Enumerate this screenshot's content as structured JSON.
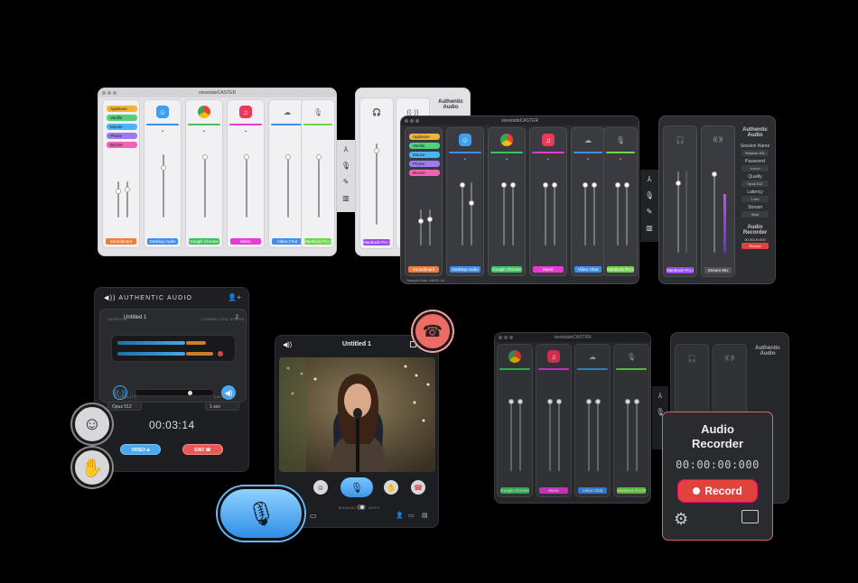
{
  "app_title": "viewstateCASTER",
  "routing_pills": [
    {
      "label": "Applause",
      "color": "#f0b43c"
    },
    {
      "label": "Vanilla",
      "color": "#4fd27a"
    },
    {
      "label": "Mouse",
      "color": "#4db3f5"
    },
    {
      "label": "Phone",
      "color": "#9b7cf2"
    },
    {
      "label": "Buzzer",
      "color": "#f064b4"
    }
  ],
  "channels": [
    {
      "name": "Soundboard",
      "color": "#f47a3a"
    },
    {
      "name": "Desktop Audio",
      "color": "#3d8ef0"
    },
    {
      "name": "Google Chrome",
      "color": "#3ec25f"
    },
    {
      "name": "Music",
      "color": "#e83ad6"
    },
    {
      "name": "Video Chat",
      "color": "#3d8ef0"
    },
    {
      "name": "MacBook Pro Mi...",
      "color": "#6fd44a"
    }
  ],
  "output_channels": [
    {
      "name": "MacBook Pro S...",
      "color": "#9b4df0"
    },
    {
      "name": "Stream Mix",
      "color": "#555"
    }
  ],
  "sample_rate": "Sample Rate: 48000 Hz",
  "side_panel": {
    "title": "Authentic Audio",
    "session_label": "Session Name",
    "session_value": "Session 401",
    "password_label": "Password",
    "password_value": "••••••••",
    "quality_label": "Quality",
    "quality_value": "Opus 512",
    "latency_label": "Latency",
    "latency_value": "1 sec",
    "stream_label": "Stream",
    "stream_value": "Start",
    "rec_title": "Audio Recorder",
    "rec_time": "00:00:00:000",
    "rec_button": "Record"
  },
  "aa": {
    "header": "AUTHENTIC AUDIO",
    "session_label": "SESSION",
    "session_name": "Untitled 1",
    "connected_label": "CONNECTED USERS",
    "connected_count": "2",
    "quality_label": "QUALITY",
    "quality_value": "Opus 512",
    "latency_label": "LATENCY",
    "latency_value": "1 sec",
    "timer": "00:03:14",
    "video_button": "VIDEO",
    "end_button": "END"
  },
  "video_call": {
    "title": "Untitled 1",
    "manual_label": "MANUAL",
    "auto_label": "AUTO"
  },
  "recorder": {
    "title_line1": "Audio",
    "title_line2": "Recorder",
    "time": "00:00:00:000",
    "record_label": "Record"
  },
  "colors": {
    "accent_blue": "#4aa8f0",
    "record_red": "#e0423e",
    "end_red": "#e85a55"
  }
}
